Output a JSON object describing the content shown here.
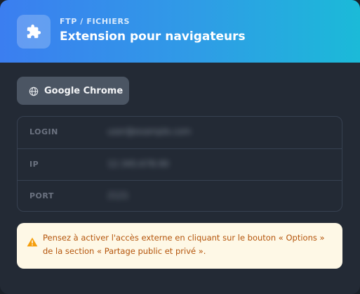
{
  "header": {
    "eyebrow": "FTP / FICHIERS",
    "title": "Extension pour navigateurs",
    "icon": "puzzle-icon"
  },
  "browser_button": {
    "label": "Google Chrome",
    "icon": "globe-icon"
  },
  "credentials": [
    {
      "key": "LOGIN",
      "value": "user@example.com"
    },
    {
      "key": "IP",
      "value": "12.345.678.90"
    },
    {
      "key": "PORT",
      "value": "2121"
    }
  ],
  "notice": {
    "icon": "warning-icon",
    "text": "Pensez à activer l'accès externe en cliquant sur le bouton « Options » de la section « Partage public et privé »."
  },
  "colors": {
    "header_gradient_start": "#3b7ef0",
    "header_gradient_end": "#1bbad8",
    "background": "#232a35",
    "button": "#4b5563",
    "notice_bg": "#fef8e6",
    "notice_text": "#b4540a",
    "warning": "#f59e0b"
  }
}
